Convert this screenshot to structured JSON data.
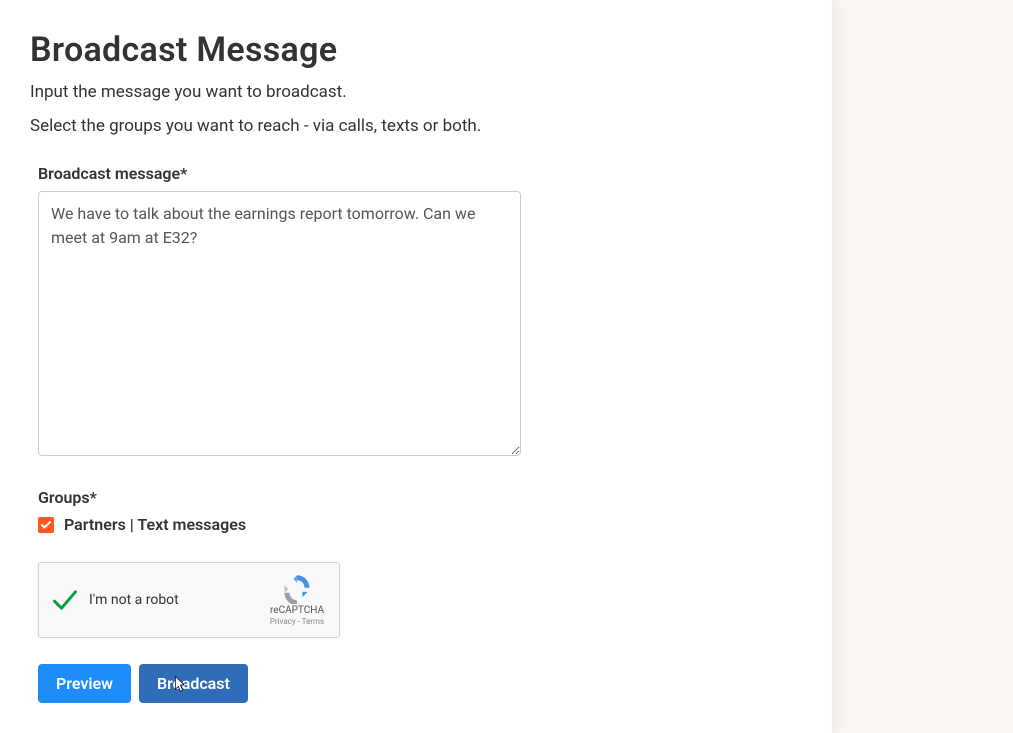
{
  "header": {
    "title": "Broadcast Message",
    "intro_line1": "Input the message you want to broadcast.",
    "intro_line2": "Select the groups you want to reach - via calls, texts or both."
  },
  "form": {
    "message_label": "Broadcast message*",
    "message_value": "We have to talk about the earnings report tomorrow. Can we meet at 9am at E32?",
    "groups_label": "Groups*",
    "groups": [
      {
        "label": "Partners | Text messages",
        "checked": true
      }
    ]
  },
  "recaptcha": {
    "text": "I'm not a robot",
    "brand": "reCAPTCHA",
    "links": "Privacy - Terms"
  },
  "buttons": {
    "preview": "Preview",
    "broadcast": "Broadcast"
  }
}
